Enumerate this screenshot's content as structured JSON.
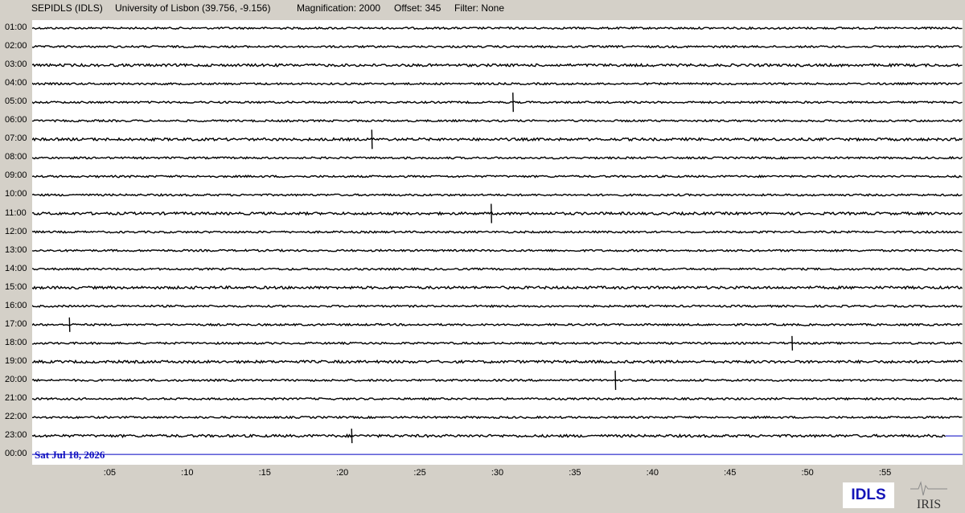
{
  "header": {
    "station": "SEPIDLS (IDLS)",
    "location": "University of Lisbon (39.756, -9.156)",
    "magnification": "Magnification: 2000",
    "offset": "Offset: 345",
    "filter": "Filter: None"
  },
  "hour_labels": [
    "01:00",
    "02:00",
    "03:00",
    "04:00",
    "05:00",
    "06:00",
    "07:00",
    "08:00",
    "09:00",
    "10:00",
    "11:00",
    "12:00",
    "13:00",
    "14:00",
    "15:00",
    "16:00",
    "17:00",
    "18:00",
    "19:00",
    "20:00",
    "21:00",
    "22:00",
    "23:00",
    "00:00"
  ],
  "minute_ticks": [
    ":05",
    ":10",
    ":15",
    ":20",
    ":25",
    ":30",
    ":35",
    ":40",
    ":45",
    ":50",
    ":55"
  ],
  "date": "Sat Jul 18, 2026",
  "station_logo": "IDLS",
  "iris_logo": "IRIS",
  "colors": {
    "trace": "#000000",
    "current_trace": "#0000c0",
    "background": "#d4d0c8",
    "logo_text": "#1515b8"
  },
  "chart_data": {
    "type": "line",
    "x": [
      0,
      60
    ],
    "events": [
      {
        "hour": "05:00",
        "minute": 31.0,
        "amplitude": "medium"
      },
      {
        "hour": "07:00",
        "minute": 21.9,
        "amplitude": "medium"
      },
      {
        "hour": "11:00",
        "minute": 29.6,
        "amplitude": "medium"
      },
      {
        "hour": "17:00",
        "minute": 2.4,
        "amplitude": "small"
      },
      {
        "hour": "18:00",
        "minute": 49.0,
        "amplitude": "small"
      },
      {
        "hour": "20:00",
        "minute": 37.6,
        "amplitude": "medium"
      },
      {
        "hour": "23:00",
        "minute": 20.6,
        "amplitude": "small"
      }
    ],
    "last_trace_end_minute": 58.9,
    "grid": false
  }
}
